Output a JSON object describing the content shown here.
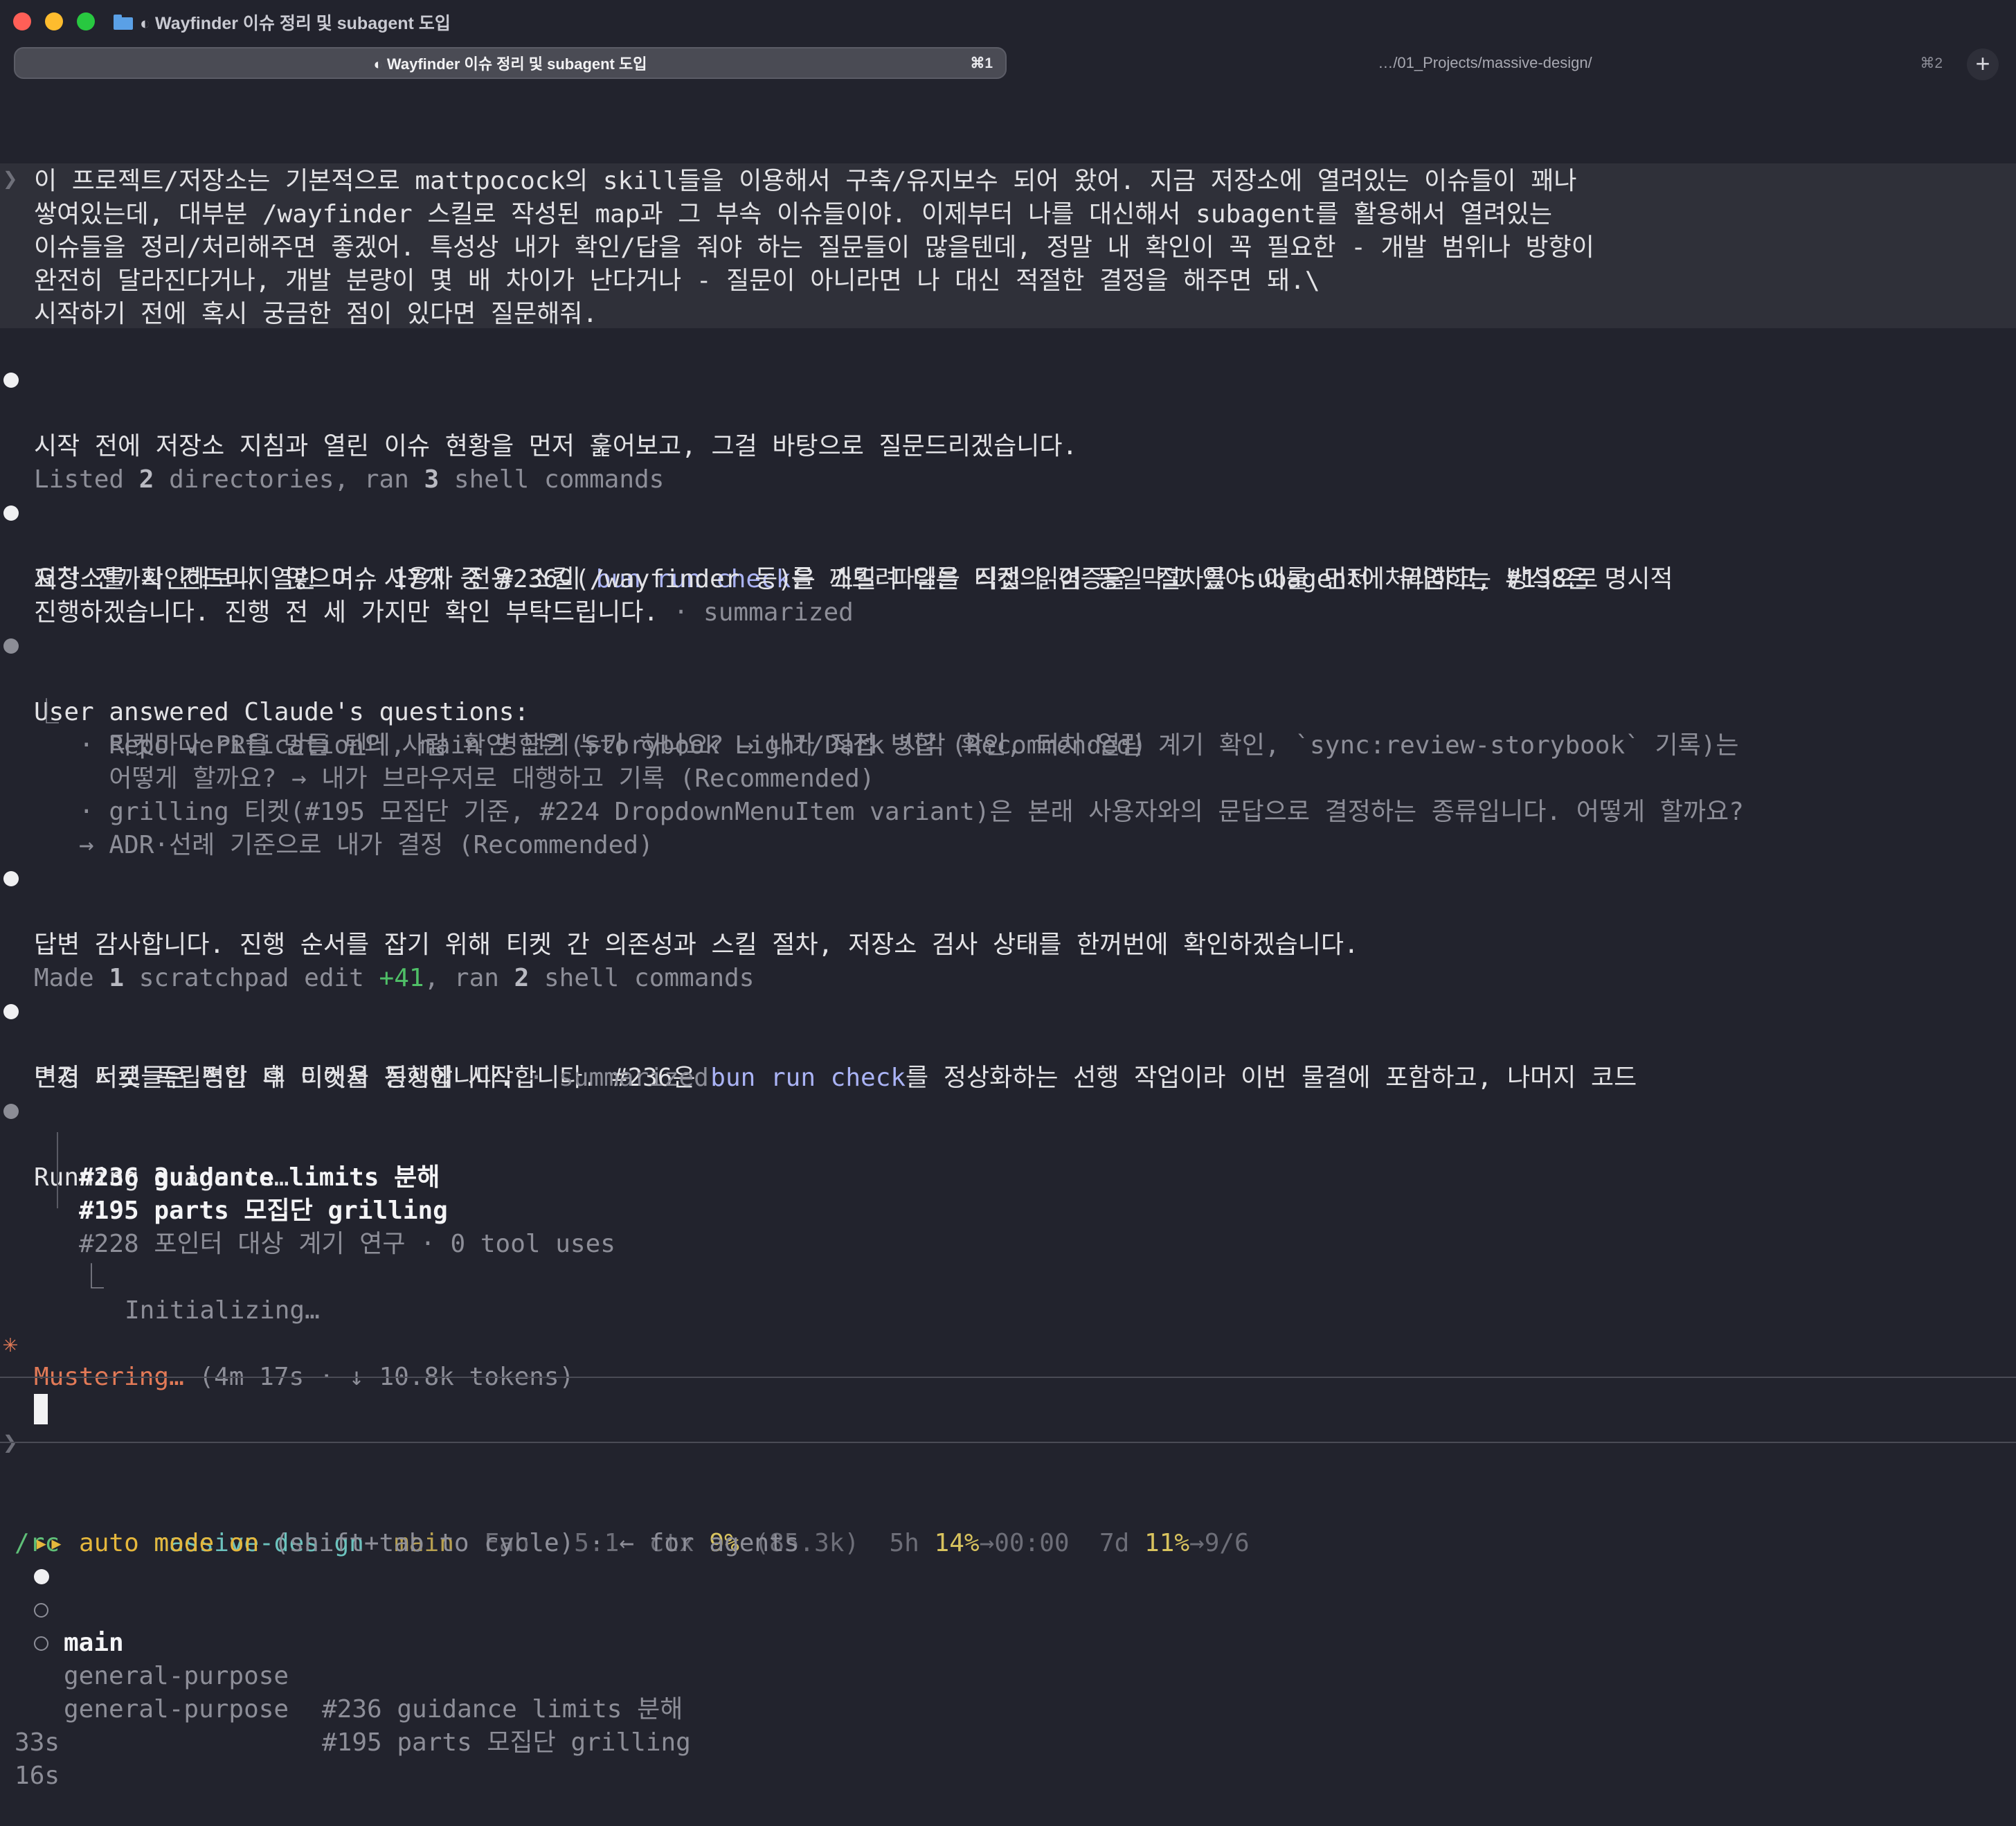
{
  "window": {
    "title": "◐ Wayfinder 이슈 정리 및 subagent 도입"
  },
  "tabs": [
    {
      "label": "◐ Wayfinder 이슈 정리 및 subagent 도입",
      "shortcut": "⌘1"
    },
    {
      "label": "…/01_Projects/massive-design/",
      "shortcut": "⌘2"
    }
  ],
  "new_tab_label": "+",
  "conversation": {
    "prompt_glyph": "❯",
    "user_prompt_lines": [
      "이 프로젝트/저장소는 기본적으로 mattpocock의 skill들을 이용해서 구축/유지보수 되어 왔어. 지금 저장소에 열려있는 이슈들이 꽤나",
      "쌓여있는데, 대부분 /wayfinder 스킬로 작성된 map과 그 부속 이슈들이야. 이제부터 나를 대신해서 subagent를 활용해서 열려있는",
      "이슈들을 정리/처리해주면 좋겠어. 특성상 내가 확인/답을 줘야 하는 질문들이 많을텐데, 정말 내 확인이 꼭 필요한 - 개발 범위나 방향이",
      "완전히 달라진다거나, 개발 분량이 몇 배 차이가 난다거나 - 질문이 아니라면 나 대신 적절한 결정을 해주면 돼.\\",
      "시작하기 전에 혹시 궁금한 점이 있다면 질문해줘."
    ],
    "msg1": "시작 전에 저장소 지침과 열린 이슈 현황을 먼저 훑어보고, 그걸 바탕으로 질문드리겠습니다.",
    "tool1": {
      "a": "Listed ",
      "n1": "2",
      "b": " directories, ran ",
      "n2": "3",
      "c": " shell commands"
    },
    "msg2": {
      "l1a": "저장소를 확인해보니 열린 이슈 17개 중 #236이 ",
      "l1cmd": "bun run check",
      "l1b": "를 깨뜨려 다른 티켓의 검증을 막고 있어 이를 먼저 처리하고, #138은 명시적",
      "l2": "요청 전까지 건드리지 않으며, 사용자 전용 스킬(/wayfinder 등)은 스킬 파일을 직접 읽어 동일 절차를 subagent에 위임하는 방식으로",
      "l3a": "진행하겠습니다. 진행 전 세 가지만 확인 부탁드립니다.",
      "l3b": " · summarized"
    },
    "answers": {
      "header": "User answered Claude's questions:",
      "corner": "⎿",
      "lines": [
        "· 티켓마다 PR을 만들 텐데, main 병합은 누가 하나요? → 내가 직접 병합 (Recommended)",
        "· Repo verification의 사람 확인 단계(Storybook Light/Dark 시각 확인, 터치·열림 계기 확인, `sync:review-storybook` 기록)는",
        "  어떻게 할까요? → 내가 브라우저로 대행하고 기록 (Recommended)",
        "· grilling 티켓(#195 모집단 기준, #224 DropdownMenuItem variant)은 본래 사용자와의 문답으로 결정하는 종류입니다. 어떻게 할까요?",
        "→ ADR·선례 기준으로 내가 결정 (Recommended)"
      ]
    },
    "msg3": "답변 감사합니다. 진행 순서를 잡기 위해 티켓 간 의존성과 스킬 절차, 저장소 검사 상태를 한꺼번에 확인하겠습니다.",
    "tool2": {
      "a": "Made ",
      "n1": "1",
      "b": " scratchpad edit ",
      "plus": "+41",
      "c": ", ran ",
      "n2": "2",
      "d": " shell commands"
    },
    "msg4": {
      "l1a": "먼저 서로 독립적인 네 티켓을 동시에 시작합니다. #236은 ",
      "l1cmd": "bun run check",
      "l1b": "를 정상화하는 선행 작업이라 이번 물결에 포함하고, 나머지 코드",
      "l2a": "변경 티켓들은 병합 후 이어서 진행합니다.",
      "l2b": " · summarized"
    },
    "agents": {
      "header_a": "Running ",
      "header_n": "3",
      "header_b": " agents…",
      "items": [
        {
          "label": "#236 guidance limits 분해"
        },
        {
          "label": "#195 parts 모집단 grilling"
        },
        {
          "label": "#228 포인터 대상 계기 연구",
          "meta": " · 0 tool uses"
        }
      ],
      "sub_corner": "⎿",
      "sub_status": "Initializing…"
    },
    "spinner": {
      "glyph": "✳",
      "verb": "Mustering…",
      "stats": " (4m 17s · ↓ 10.8k tokens)"
    }
  },
  "input": {
    "prompt_glyph": "❯",
    "value": ""
  },
  "statusline": {
    "project": "massive-design",
    "branch": "main",
    "model": "Fable 5.1",
    "ctx_label": "ctx ",
    "ctx_pct": "9%",
    "ctx_detail": " (85.3k)",
    "h5_label": "5h ",
    "h5_pct": "14%",
    "h5_reset": "→00:00",
    "d7_label": "7d ",
    "d7_pct": "11%",
    "d7_reset": "→9/6",
    "right": "/rc",
    "mode_glyph": "▸▸",
    "mode_label": "auto mode on",
    "mode_hint": " (shift+tab to cycle) · ← for agents"
  },
  "agent_panel": {
    "main_label": "main",
    "rows": [
      {
        "type": "general-purpose",
        "task": "#236 guidance limits 분해",
        "time": "33s"
      },
      {
        "type": "general-purpose",
        "task": "#195 parts 모집단 grilling",
        "time": "16s"
      }
    ]
  },
  "colors": {
    "background": "#22232d",
    "command": "#aab3f5",
    "spinner": "#e27a57",
    "project": "#6cc2bd",
    "branch": "#c8b46a",
    "diff_plus": "#4fbf67"
  }
}
